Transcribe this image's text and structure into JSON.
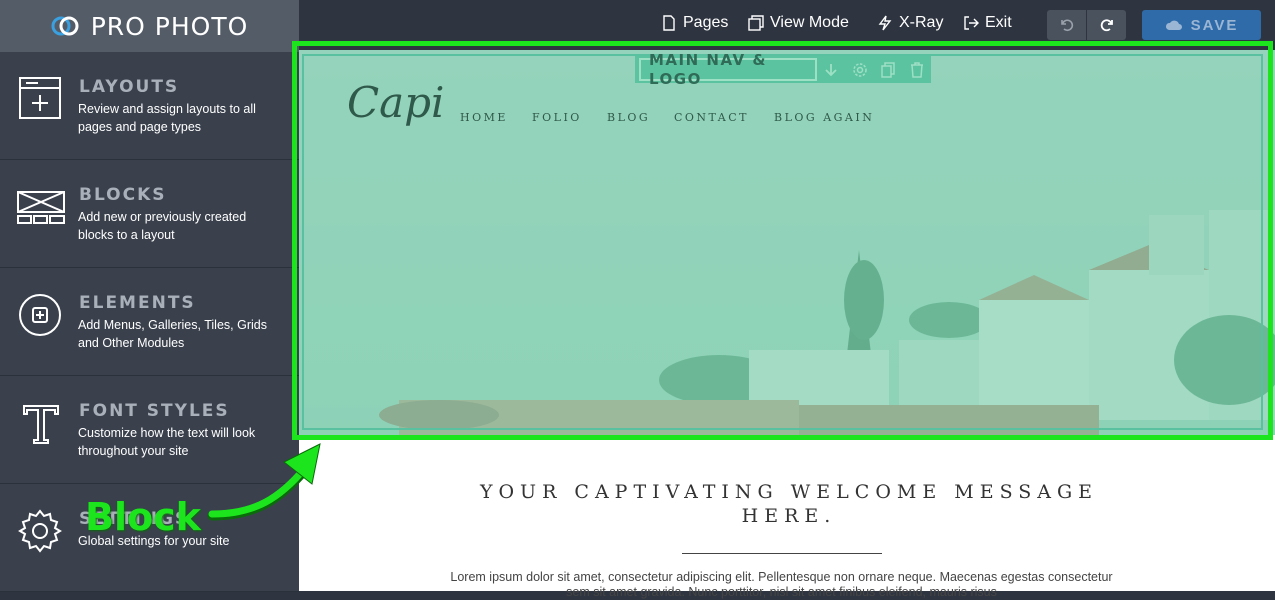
{
  "app": {
    "brand": "PRO PHOTO"
  },
  "sidebar": {
    "items": [
      {
        "title": "LAYOUTS",
        "desc": "Review and assign layouts to all pages and page types",
        "icon": "layout-add-icon"
      },
      {
        "title": "BLOCKS",
        "desc": "Add new or previously created blocks to a layout",
        "icon": "blocks-icon"
      },
      {
        "title": "ELEMENTS",
        "desc": "Add Menus, Galleries, Tiles, Grids and Other Modules",
        "icon": "plus-circle-icon"
      },
      {
        "title": "FONT STYLES",
        "desc": "Customize how the text will look throughout your site",
        "icon": "font-t-icon"
      },
      {
        "title": "SETTINGS",
        "desc": "Global settings for your site",
        "icon": "gear-icon"
      }
    ]
  },
  "topbar": {
    "pages": "Pages",
    "view_mode": "View Mode",
    "xray": "X-Ray",
    "exit": "Exit",
    "save": "SAVE"
  },
  "block": {
    "label": "MAIN NAV & LOGO",
    "tools": [
      "move-down-icon",
      "gear-icon",
      "copy-icon",
      "trash-icon"
    ]
  },
  "site": {
    "logo": "Capi",
    "nav": [
      "HOME",
      "FOLIO",
      "BLOG",
      "CONTACT",
      "BLOG AGAIN"
    ],
    "welcome": "YOUR CAPTIVATING WELCOME MESSAGE HERE.",
    "lorem": "Lorem ipsum dolor sit amet, consectetur adipiscing elit. Pellentesque non ornare neque. Maecenas egestas consectetur sem sit amet gravida. Nunc porttitor, nisl sit amet finibus eleifend, mauris risus"
  },
  "annotation": {
    "label": "Block",
    "color": "#1de51d"
  },
  "colors": {
    "accent_save": "#2e6ba8",
    "overlay": "#78d2af",
    "sidebar_bg": "#3a414d"
  }
}
